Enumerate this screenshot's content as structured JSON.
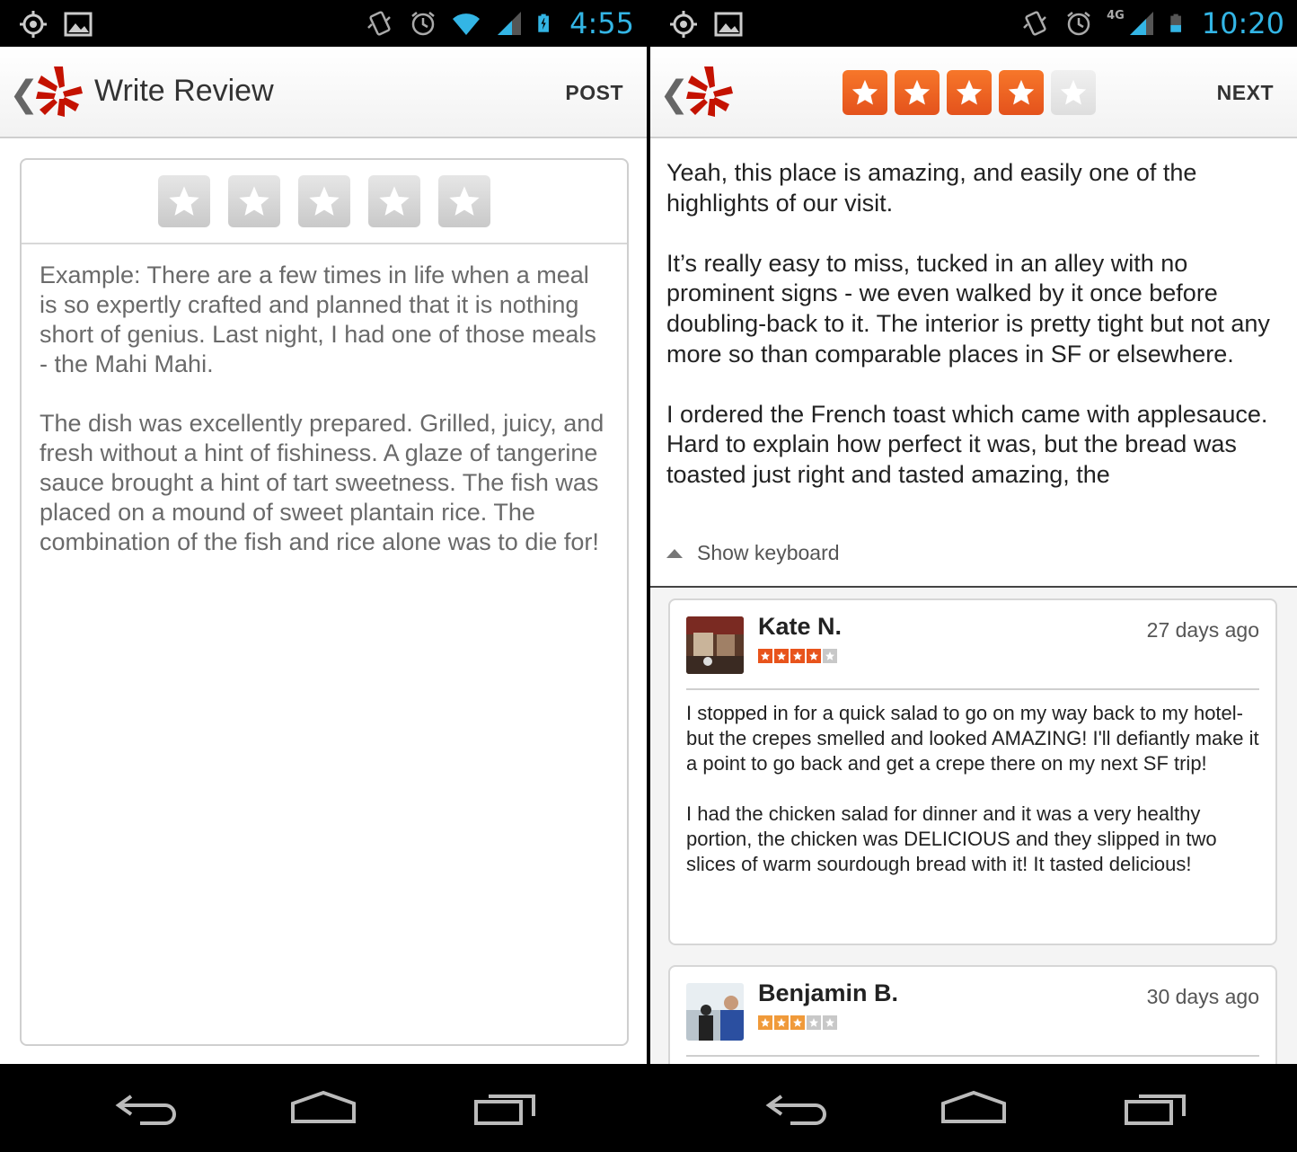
{
  "left": {
    "status": {
      "time": "4:55"
    },
    "actionbar": {
      "back": "❮",
      "title": "Write Review",
      "action": "POST"
    },
    "rating": {
      "selected": 0,
      "max": 5
    },
    "review_placeholder": "Example: There are a few times in life when a meal is so expertly crafted and planned that it is nothing short of genius. Last night, I had one of those meals - the Mahi Mahi.\n\nThe dish was excellently prepared. Grilled, juicy, and fresh without a hint of fishiness. A glaze of tangerine sauce brought a hint of tart sweetness. The fish was placed on a mound of sweet plantain rice. The combination of the fish and rice alone was to die for!"
  },
  "right": {
    "status": {
      "time": "10:20",
      "network": "4G"
    },
    "actionbar": {
      "back": "❮",
      "action": "NEXT"
    },
    "rating": {
      "selected": 4,
      "max": 5
    },
    "review_text": "Yeah, this place is amazing, and easily one of the highlights of our visit.\n\nIt’s really easy to miss, tucked in an alley with no prominent signs - we even walked by it once before doubling-back to it. The interior is pretty tight but not any more so than comparable places in SF or elsewhere.\n\nI ordered the French toast which came with applesauce. Hard to explain how perfect it was, but the bread was toasted just right and tasted amazing, the",
    "show_keyboard": "Show keyboard",
    "reviews": [
      {
        "name": "Kate N.",
        "date": "27 days ago",
        "stars": 4,
        "body": "I stopped in for a quick salad to go on my way back to my hotel- but the crepes smelled and looked AMAZING! I'll defiantly make it a point to go back and get a crepe there on my next SF trip!\n\nI had the chicken salad for dinner and it was a very healthy portion, the chicken was DELICIOUS and they slipped in two slices of warm sourdough bread with it! It tasted delicious!"
      },
      {
        "name": "Benjamin B.",
        "date": "30 days ago",
        "stars": 3,
        "body": ""
      }
    ]
  },
  "icons": {
    "status_left": [
      "gps-icon",
      "image-notification-icon"
    ],
    "status_right": [
      "vibrate-icon",
      "alarm-icon",
      "signal-icon",
      "battery-icon"
    ],
    "nav": [
      "back-nav-icon",
      "home-nav-icon",
      "recents-nav-icon"
    ]
  },
  "colors": {
    "accent": "#33b5e5",
    "star_on": "#e4521c",
    "yelp_red": "#c41200"
  }
}
